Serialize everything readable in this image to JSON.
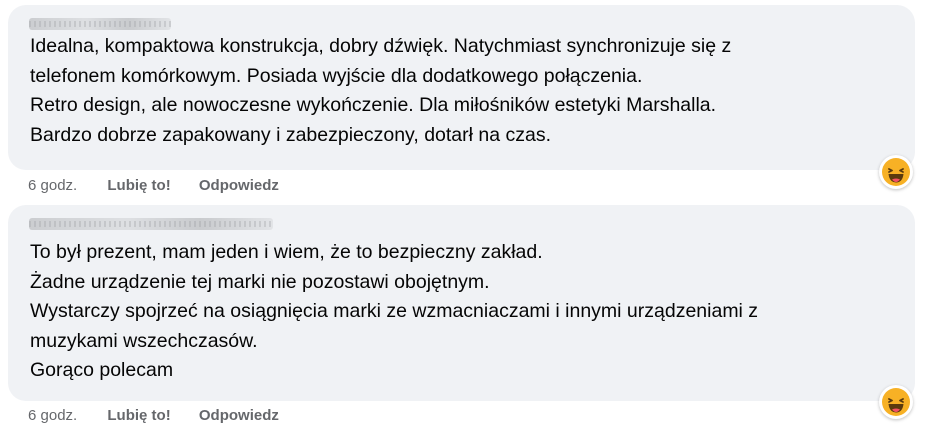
{
  "comments": [
    {
      "author": "",
      "lines": [
        "Idealna, kompaktowa konstrukcja, dobry dźwięk. Natychmiast synchronizuje się z",
        "telefonem komórkowym. Posiada wyjście dla dodatkowego połączenia.",
        "Retro design, ale nowoczesne wykończenie. Dla miłośników estetyki Marshalla.",
        "Bardzo dobrze zapakowany i zabezpieczony, dotarł na czas."
      ],
      "time": "6 godz.",
      "like_label": "Lubię to!",
      "reply_label": "Odpowiedz",
      "reaction_icon": "haha-emoji-icon"
    },
    {
      "author": "",
      "lines": [
        "To był prezent, mam jeden i wiem, że to bezpieczny zakład.",
        "Żadne urządzenie tej marki nie pozostawi obojętnym.",
        "Wystarczy spojrzeć na osiągnięcia marki ze wzmacniaczami i innymi urządzeniami z",
        "muzykami wszechczasów.",
        "Gorąco polecam"
      ],
      "time": "6 godz.",
      "like_label": "Lubię to!",
      "reply_label": "Odpowiedz",
      "reaction_icon": "haha-emoji-icon"
    }
  ],
  "colors": {
    "bubble": "#f0f2f5",
    "text": "#050505",
    "meta": "#65676b",
    "emoji_face": "#f7b125",
    "emoji_mouth": "#5a3a0e"
  }
}
